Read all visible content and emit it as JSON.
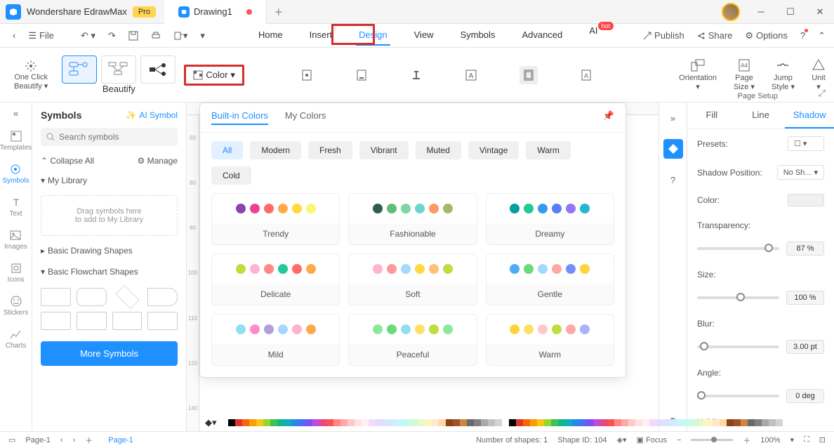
{
  "titlebar": {
    "app_name": "Wondershare EdrawMax",
    "pro": "Pro",
    "tab_name": "Drawing1"
  },
  "toolbar": {
    "file": "File",
    "home": "Home",
    "insert": "Insert",
    "design": "Design",
    "view": "View",
    "symbols": "Symbols",
    "advanced": "Advanced",
    "ai": "AI",
    "hot": "hot",
    "publish": "Publish",
    "share": "Share",
    "options": "Options"
  },
  "ribbon": {
    "one_click": "One Click",
    "beautify": "Beautify",
    "beautify2": "Beautify",
    "color": "Color",
    "orientation": "Orientation",
    "page_size": "Page Size",
    "jump_style": "Jump Style",
    "unit": "Unit",
    "page_setup": "Page Setup"
  },
  "rail": [
    "Templates",
    "Symbols",
    "Text",
    "Images",
    "Icons",
    "Stickers",
    "Charts"
  ],
  "left": {
    "symbols": "Symbols",
    "ai_symbol": "AI Symbol",
    "search_ph": "Search symbols",
    "collapse": "Collapse All",
    "manage": "Manage",
    "my_lib": "My Library",
    "drop_hint1": "Drag symbols here",
    "drop_hint2": "to add to My Library",
    "cat1": "Basic Drawing Shapes",
    "cat2": "Basic Flowchart Shapes",
    "more": "More Symbols"
  },
  "ruler": [
    "60",
    "80",
    "90",
    "100",
    "110",
    "120",
    "140"
  ],
  "popup": {
    "builtin": "Built-in Colors",
    "my_colors": "My Colors",
    "filters": [
      "All",
      "Modern",
      "Fresh",
      "Vibrant",
      "Muted",
      "Vintage",
      "Warm",
      "Cold"
    ],
    "cards": [
      {
        "name": "Trendy",
        "c": [
          "#8e44ad",
          "#e84393",
          "#ff6b6b",
          "#ffa94d",
          "#ffd93d",
          "#f9f871"
        ]
      },
      {
        "name": "Fashionable",
        "c": [
          "#2f5d50",
          "#5fbf77",
          "#7ed6a5",
          "#6dd5cf",
          "#ff9966",
          "#a3b86c"
        ]
      },
      {
        "name": "Dreamy",
        "c": [
          "#00a0a0",
          "#20c997",
          "#339af0",
          "#5c7cfa",
          "#9775fa",
          "#22b8cf"
        ]
      },
      {
        "name": "Delicate",
        "c": [
          "#c0dc3f",
          "#ffb3d1",
          "#ff8787",
          "#20c997",
          "#ff6b6b",
          "#ffa94d"
        ]
      },
      {
        "name": "Soft",
        "c": [
          "#ffb3d1",
          "#ff9999",
          "#a5d8ff",
          "#ffd93d",
          "#ffc078",
          "#c0dc3f"
        ]
      },
      {
        "name": "Gentle",
        "c": [
          "#4dabf7",
          "#69db7c",
          "#a5d8ff",
          "#ffa8a8",
          "#748ffc",
          "#ffd43b"
        ]
      },
      {
        "name": "Mild",
        "c": [
          "#91dff0",
          "#ff8cc6",
          "#b39ddb",
          "#a5d8ff",
          "#ffb3d1",
          "#ffa94d"
        ]
      },
      {
        "name": "Peaceful",
        "c": [
          "#8ce99a",
          "#69db7c",
          "#91dff0",
          "#ffe066",
          "#c0dc3f",
          "#8ce99a"
        ]
      },
      {
        "name": "Warm",
        "c": [
          "#ffd43b",
          "#ffe066",
          "#ffc9c9",
          "#c0dc3f",
          "#ffa8a8",
          "#a5b4fc"
        ]
      }
    ]
  },
  "right": {
    "fill": "Fill",
    "line": "Line",
    "shadow": "Shadow",
    "presets": "Presets:",
    "position": "Shadow Position:",
    "no_sh": "No Sh...",
    "color": "Color:",
    "transparency": "Transparency:",
    "size": "Size:",
    "blur": "Blur:",
    "angle": "Angle:",
    "xoffset": "X Offset:",
    "t_val": "87 %",
    "s_val": "100 %",
    "b_val": "3.00 pt",
    "a_val": "0 deg"
  },
  "status": {
    "page1": "Page-1",
    "page1t": "Page-1",
    "shapes": "Number of shapes: 1",
    "shape_id": "Shape ID: 104",
    "focus": "Focus",
    "zoom": "100%"
  }
}
